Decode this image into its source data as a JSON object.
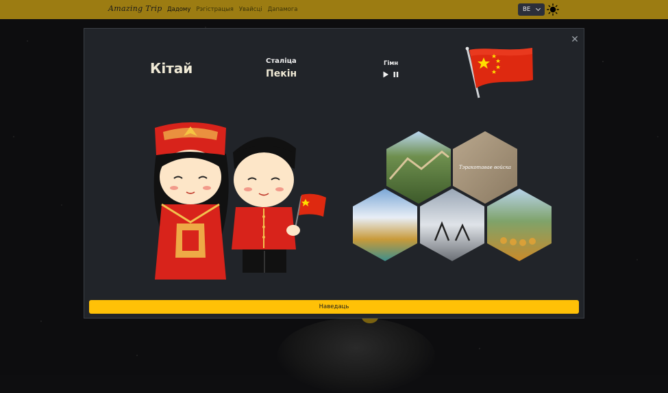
{
  "navbar": {
    "brand": "Amazing Trip",
    "links": [
      "Дадому",
      "Рэгістрацыя",
      "Увайсці",
      "Дапамога"
    ],
    "language": "BE",
    "theme_icon": "sun-icon"
  },
  "modal": {
    "country": "Кітай",
    "capital_label": "Сталіца",
    "capital": "Пекін",
    "anthem_label": "Гімн",
    "gallery_caption": "Тэракотавае войска",
    "visit_button": "Наведаць",
    "close_icon": "close-icon",
    "play_icon": "play-icon",
    "pause_icon": "pause-icon"
  },
  "colors": {
    "navbar_bg": "#9c7c12",
    "modal_bg": "#212429",
    "accent": "#ffc107",
    "flag_red": "#de2910",
    "flag_star": "#ffde00"
  }
}
